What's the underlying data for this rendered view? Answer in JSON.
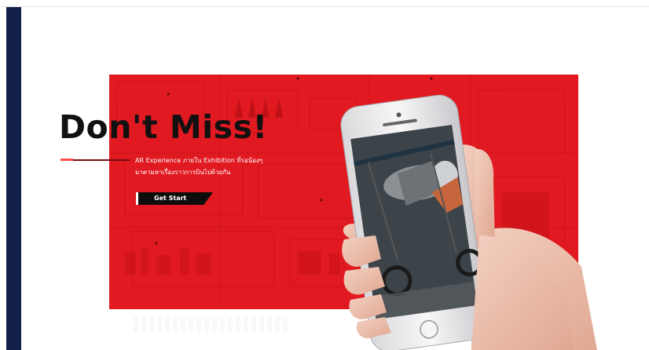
{
  "hero": {
    "headline": "Don't Miss!",
    "subtitle_line1": "AR Experience ภายใน Exhibition ที่รอน้องๆ",
    "subtitle_line2": "มาตามหาเรื่องราวการบินไปด้วยกัน",
    "cta_label": "Get Start"
  },
  "colors": {
    "hero_red": "#e11920",
    "sidebar_navy": "#15204a",
    "text_dark": "#111111",
    "button_black": "#0d0d0d"
  },
  "icons": {
    "phone": "smartphone-icon",
    "hand": "hand-icon",
    "airplane": "biplane-photo"
  }
}
